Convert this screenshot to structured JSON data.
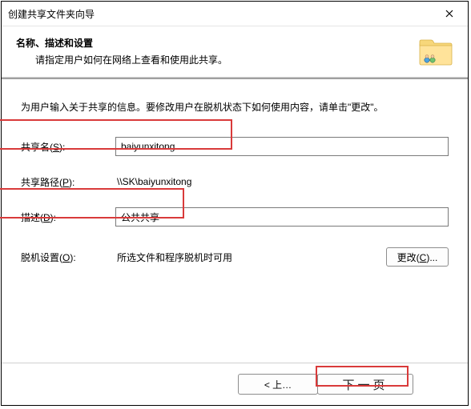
{
  "window": {
    "title": "创建共享文件夹向导"
  },
  "header": {
    "heading": "名称、描述和设置",
    "sub": "请指定用户如何在网络上查看和使用此共享。"
  },
  "intro": "为用户输入关于共享的信息。要修改用户在脱机状态下如何使用内容，请单击\"更改\"。",
  "fields": {
    "share_name": {
      "label_pre": "共享名(",
      "label_hot": "S",
      "label_post": "):",
      "value": "baiyunxitong"
    },
    "share_path": {
      "label_pre": "共享路径(",
      "label_hot": "P",
      "label_post": "):",
      "value": "\\\\SK\\baiyunxitong"
    },
    "description": {
      "label_pre": "描述(",
      "label_hot": "D",
      "label_post": "):",
      "value": "公共共享"
    },
    "offline": {
      "label_pre": "脱机设置(",
      "label_hot": "O",
      "label_post": "):",
      "value": "所选文件和程序脱机时可用"
    }
  },
  "buttons": {
    "change": {
      "pre": "更改(",
      "hot": "C",
      "post": ")..."
    },
    "back": "< 上…",
    "next": "下一页"
  }
}
